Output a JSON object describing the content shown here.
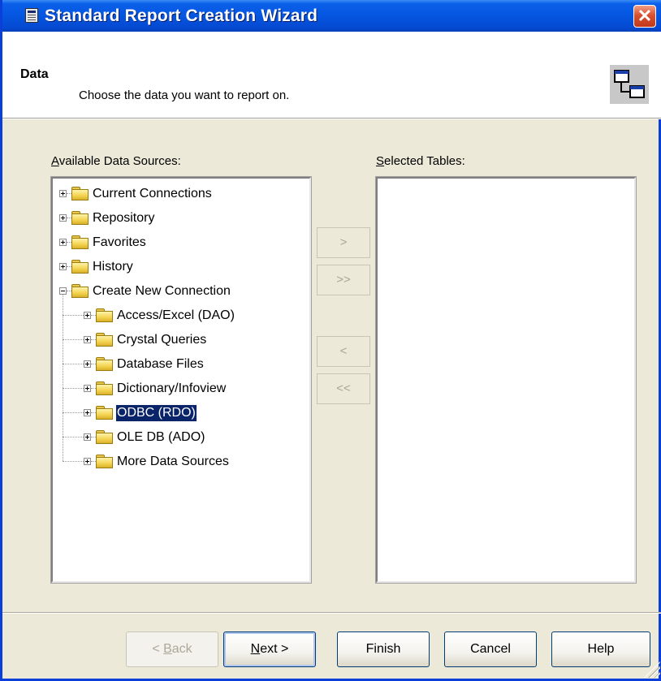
{
  "window": {
    "title": "Standard Report Creation Wizard",
    "close_label": "✕"
  },
  "header": {
    "title": "Data",
    "subtitle": "Choose the data you want to report on."
  },
  "available": {
    "label_underline": "A",
    "label_rest": "vailable Data Sources:",
    "items": [
      {
        "label": "Current Connections",
        "expander": "+",
        "depth": 0
      },
      {
        "label": "Repository",
        "expander": "+",
        "depth": 0
      },
      {
        "label": "Favorites",
        "expander": "+",
        "depth": 0
      },
      {
        "label": "History",
        "expander": "+",
        "depth": 0
      },
      {
        "label": "Create New Connection",
        "expander": "-",
        "depth": 0
      },
      {
        "label": "Access/Excel (DAO)",
        "expander": "+",
        "depth": 1
      },
      {
        "label": "Crystal Queries",
        "expander": "+",
        "depth": 1
      },
      {
        "label": "Database Files",
        "expander": "+",
        "depth": 1
      },
      {
        "label": "Dictionary/Infoview",
        "expander": "+",
        "depth": 1
      },
      {
        "label": "ODBC (RDO)",
        "expander": "+",
        "depth": 1,
        "selected": true
      },
      {
        "label": "OLE DB (ADO)",
        "expander": "+",
        "depth": 1
      },
      {
        "label": "More Data Sources",
        "expander": "+",
        "depth": 1
      }
    ]
  },
  "selected": {
    "label_underline": "S",
    "label_rest": "elected Tables:"
  },
  "transfer": {
    "add": ">",
    "add_all": ">>",
    "remove": "<",
    "remove_all": "<<"
  },
  "footer": {
    "back_underline": "B",
    "back_prefix": "< ",
    "back_rest": "ack",
    "next_underline": "N",
    "next_rest": "ext >",
    "finish": "Finish",
    "cancel": "Cancel",
    "help": "Help"
  }
}
